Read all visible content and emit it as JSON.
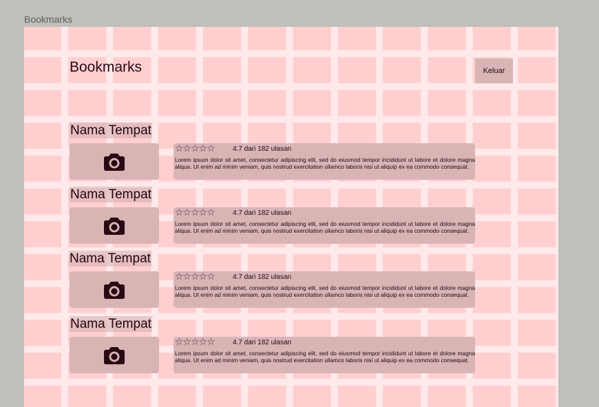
{
  "frame_label": "Bookmarks",
  "page": {
    "title": "Bookmarks",
    "logout_label": "Keluar"
  },
  "places": [
    {
      "name": "Nama Tempat",
      "stars": "☆☆☆☆☆",
      "rating": "4.7 dari 182 ulasan",
      "description": "Lorem ipsum dolor sit amet, consectetur adipiscing elit, sed do eiusmod tempor incididunt ut labore et dolore magna aliqua. Ut enim ad minim veniam, quis nostrud exercitation ullamco laboris nisi ut aliquip ex ea commodo consequat.",
      "image_icon": "camera-icon"
    },
    {
      "name": "Nama Tempat",
      "stars": "☆☆☆☆☆",
      "rating": "4.7 dari 182 ulasan",
      "description": "Lorem ipsum dolor sit amet, consectetur adipiscing elit, sed do eiusmod tempor incididunt ut labore et dolore magna aliqua. Ut enim ad minim veniam, quis nostrud exercitation ullamco laboris nisi ut aliquip ex ea commodo consequat.",
      "image_icon": "camera-icon"
    },
    {
      "name": "Nama Tempat",
      "stars": "☆☆☆☆☆",
      "rating": "4.7 dari 182 ulasan",
      "description": "Lorem ipsum dolor sit amet, consectetur adipiscing elit, sed do eiusmod tempor incididunt ut labore et dolore magna aliqua. Ut enim ad minim veniam, quis nostrud exercitation ullamco laboris nisi ut aliquip ex ea commodo consequat.",
      "image_icon": "camera-icon"
    },
    {
      "name": "Nama Tempat",
      "stars": "☆☆☆☆☆",
      "rating": "4.7 dari 182 ulasan",
      "description": "Lorem ipsum dolor sit amet, consectetur adipiscing elit, sed do eiusmod tempor incididunt ut labore et dolore magna aliqua. Ut enim ad minim veniam, quis nostrud exercitation ullamco laboris nisi ut aliquip ex ea commodo consequat.",
      "image_icon": "camera-icon"
    }
  ],
  "colors": {
    "canvas_bg": "#bfbfbb",
    "frame_bg": "#ffcfd0",
    "grid_line": "#ffe9ea",
    "card_bg": "#d9b4b5",
    "icon": "#2a0a12"
  }
}
